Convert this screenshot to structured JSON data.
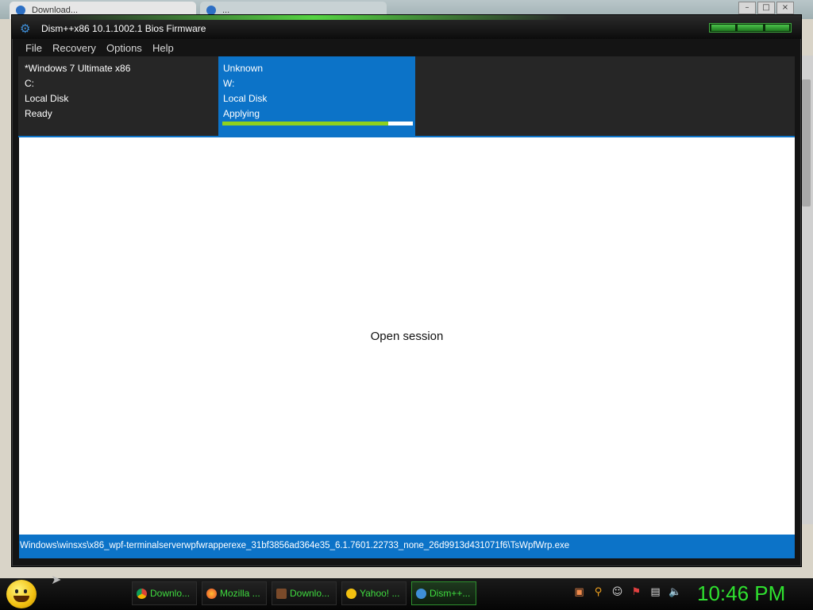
{
  "background_window": {
    "tab1_label": "Download...",
    "tab2_label": "...",
    "controls": [
      "–",
      "□",
      "×"
    ]
  },
  "window": {
    "title": "Dism++x86 10.1.1002.1 Bios Firmware",
    "icon": "gear-icon"
  },
  "menu": {
    "items": [
      "File",
      "Recovery",
      "Options",
      "Help"
    ]
  },
  "sessions": [
    {
      "name": "*Windows 7 Ultimate x86",
      "drive": "C:",
      "type": "Local Disk",
      "status": "Ready"
    },
    {
      "name": "Unknown",
      "drive": "W:",
      "type": "Local Disk",
      "status": "Applying",
      "progress_percent": 87
    }
  ],
  "content": {
    "message": "Open session"
  },
  "statusbar": {
    "path": "Windows\\winsxs\\x86_wpf-terminalserverwpfwrapperexe_31bf3856ad364e35_6.1.7601.22733_none_26d9913d431071f6\\TsWpfWrp.exe"
  },
  "taskbar": {
    "tasks": [
      {
        "label": "Downlo...",
        "icon": "chrome-icon"
      },
      {
        "label": "Mozilla ...",
        "icon": "firefox-icon"
      },
      {
        "label": "Downlo...",
        "icon": "download-icon"
      },
      {
        "label": "Yahoo! ...",
        "icon": "yahoo-icon"
      },
      {
        "label": "Dism++...",
        "icon": "gear-icon",
        "active": true
      }
    ],
    "clock": "10:46 PM"
  },
  "colors": {
    "accent": "#0c73c8",
    "progress": "#8fd11e",
    "clock": "#2fe02f"
  }
}
